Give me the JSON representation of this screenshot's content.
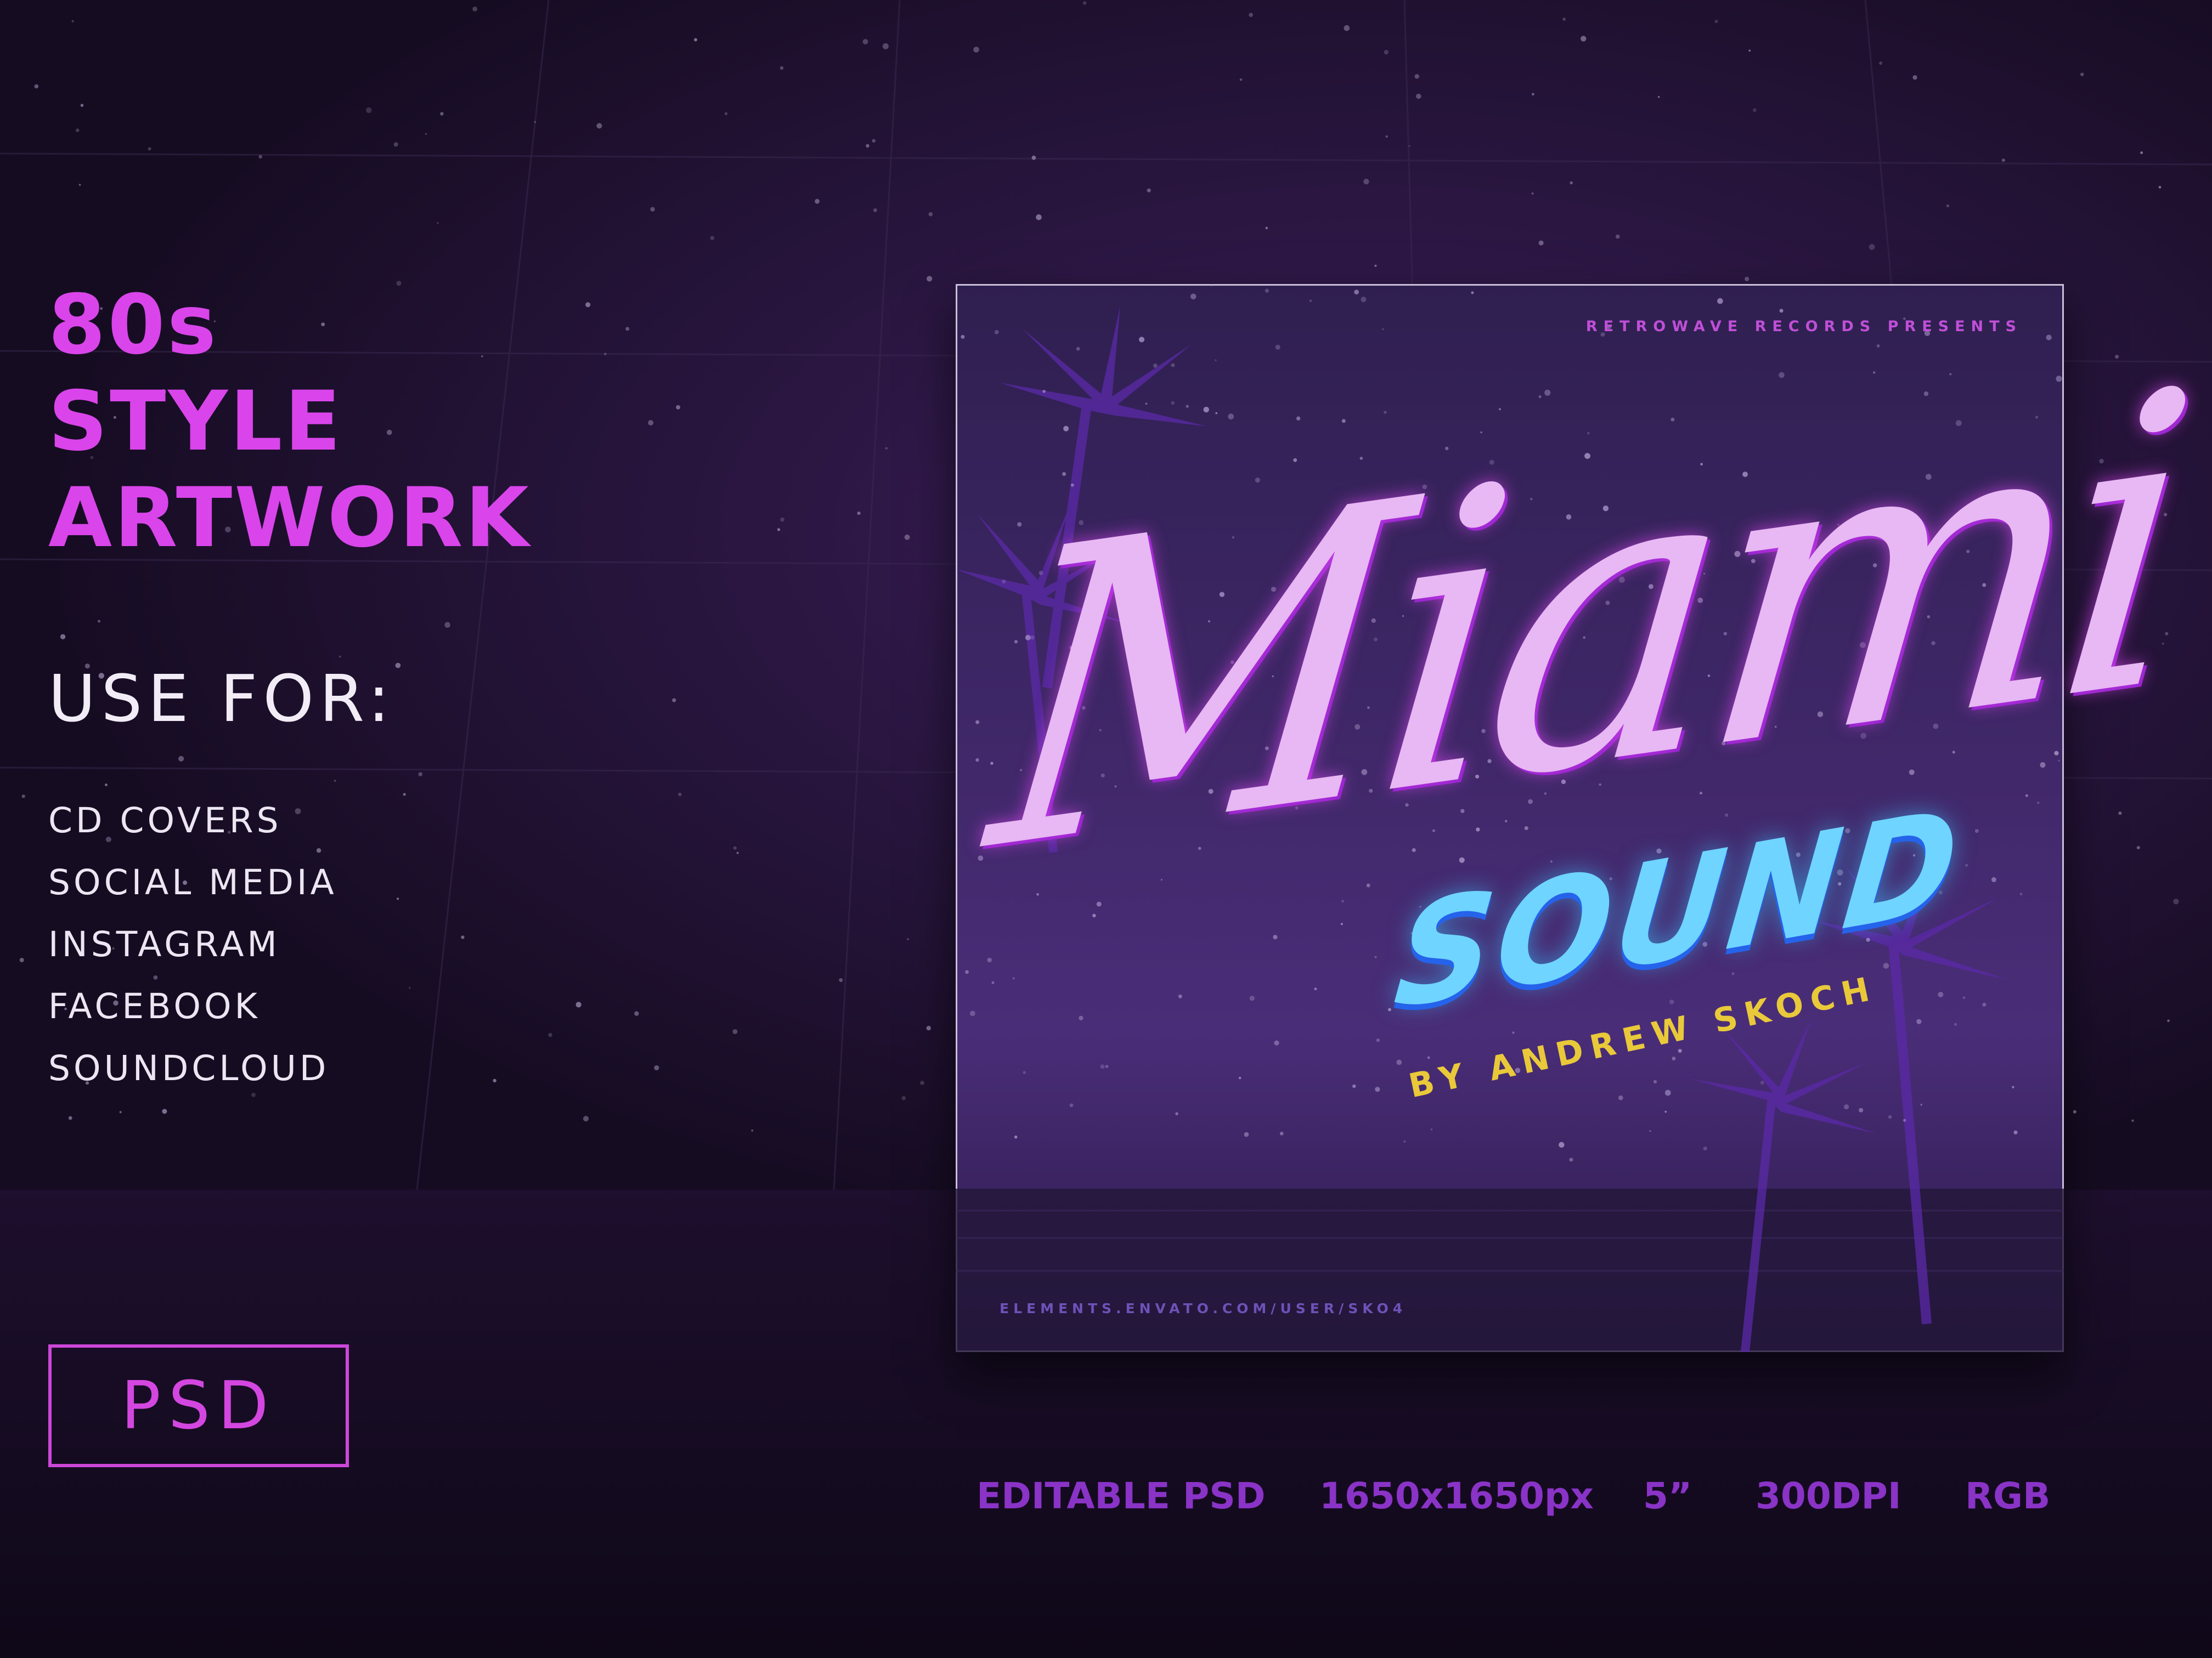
{
  "headline": {
    "line1": "80s",
    "line2": "STYLE",
    "line3": "ARTWORK"
  },
  "use_for": {
    "label": "USE FOR:",
    "items": [
      "CD COVERS",
      "SOCIAL MEDIA",
      "INSTAGRAM",
      "FACEBOOK",
      "SOUNDCLOUD"
    ]
  },
  "format_badge": "PSD",
  "specs": [
    "EDITABLE PSD",
    "1650x1650px",
    "5”",
    "300DPI",
    "RGB"
  ],
  "cover": {
    "presents": "RETROWAVE RECORDS PRESENTS",
    "title_script": "Miami",
    "title_block": "SOUND",
    "byline": "BY ANDREW SKOCH",
    "url": "ELEMENTS.ENVATO.COM/USER/SKO4"
  },
  "colors": {
    "background": "#1a0f26",
    "headline": "#d945ea",
    "spec_text": "#8a33c7",
    "cover_base": "#3b2466",
    "byline": "#e9c93a",
    "block_title": "#6fd4ff"
  }
}
